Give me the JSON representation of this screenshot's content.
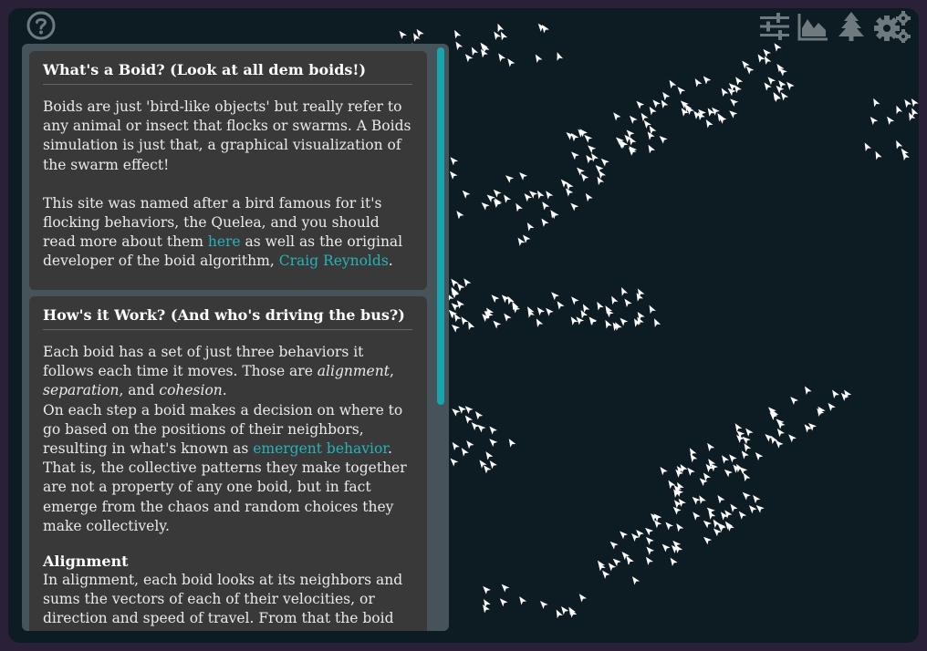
{
  "colors": {
    "background": "#0d1b22",
    "frame": "#2a2138",
    "panel": "#465359",
    "card": "#393939",
    "accent": "#25b3b8",
    "icon": "#6f7a7f",
    "boid": "#ffffff"
  },
  "icons": {
    "help": "question-circle-icon",
    "sliders": "sliders-icon",
    "chart": "area-chart-icon",
    "tree": "tree-icon",
    "settings": "gears-icon"
  },
  "cards": [
    {
      "title": "What's a Boid? (Look at all dem boids!)",
      "p1": "Boids are just 'bird-like objects' but really refer to any animal or insect that flocks or swarms. A Boids simulation is just that, a graphical visualization of the swarm effect!",
      "p2_before": "This site was named after a bird famous for it's flocking behaviors, the Quelea, and you should read more about them ",
      "p2_link1": "here",
      "p2_middle": " as well as the original developer of the boid algorithm, ",
      "p2_link2": "Craig Reynolds",
      "p2_after": "."
    },
    {
      "title": "How's it Work? (And who's driving the bus?)",
      "p1_start": "Each boid has a set of just three behaviors it follows each time it moves. Those are ",
      "p1_em1": "alignment",
      "p1_sep1": ", ",
      "p1_em2": "separation",
      "p1_sep2": ", and ",
      "p1_em3": "cohesion",
      "p1_end": ".",
      "p2_before": "On each step a boid makes a decision on where to go based on the positions of their neighbors, resulting in what's known as ",
      "p2_link": "emergent behavior",
      "p2_after": ". That is, the collective patterns they make together are not a property of any one boid, but in fact emerge from the chaos and random choices they make collectively.",
      "subheading": "Alignment",
      "p3": "In alignment, each boid looks at its neighbors and sums the vectors of each of their velocities, or direction and speed of travel. From that the boid gets an average and multiplies it by some factor, adjusting"
    }
  ]
}
